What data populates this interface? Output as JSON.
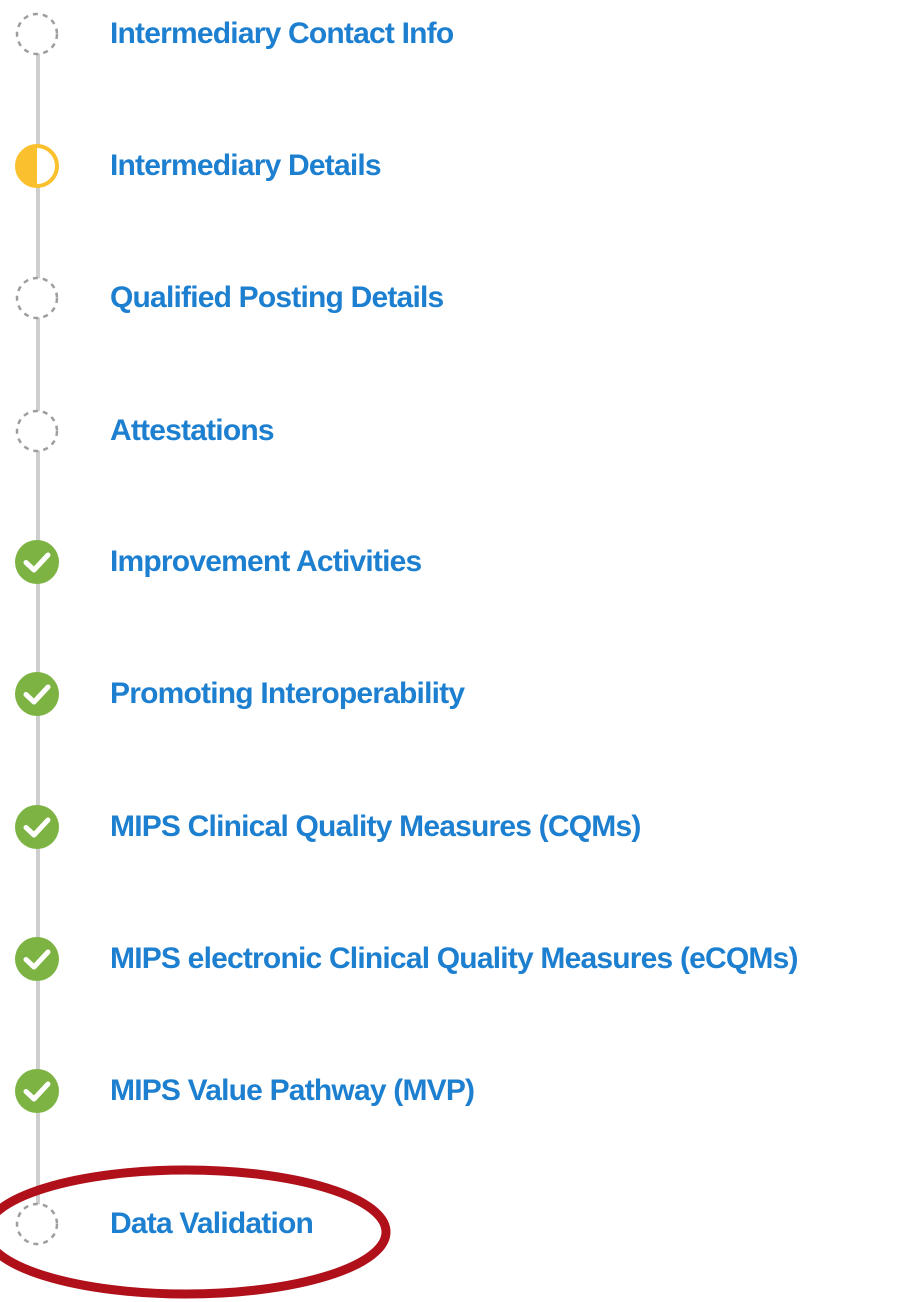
{
  "steps": [
    {
      "label": "Intermediary Contact Info",
      "status": "not-started",
      "status_icon": "dashed-circle-icon"
    },
    {
      "label": "Intermediary Details",
      "status": "in-progress",
      "status_icon": "half-filled-circle-icon"
    },
    {
      "label": "Qualified Posting Details",
      "status": "not-started",
      "status_icon": "dashed-circle-icon"
    },
    {
      "label": "Attestations",
      "status": "not-started",
      "status_icon": "dashed-circle-icon"
    },
    {
      "label": "Improvement Activities",
      "status": "complete",
      "status_icon": "check-circle-icon"
    },
    {
      "label": "Promoting Interoperability",
      "status": "complete",
      "status_icon": "check-circle-icon"
    },
    {
      "label": "MIPS Clinical Quality Measures (CQMs)",
      "status": "complete",
      "status_icon": "check-circle-icon"
    },
    {
      "label": "MIPS electronic Clinical Quality Measures (eCQMs)",
      "status": "complete",
      "status_icon": "check-circle-icon"
    },
    {
      "label": "MIPS Value Pathway (MVP)",
      "status": "complete",
      "status_icon": "check-circle-icon"
    },
    {
      "label": "Data Validation",
      "status": "not-started",
      "status_icon": "dashed-circle-icon",
      "highlighted": true
    }
  ],
  "colors": {
    "link": "#1d7fcf",
    "complete": "#7cb342",
    "in_progress": "#fbc02d",
    "not_started_stroke": "#9e9e9e",
    "rail": "#cfcfcf",
    "highlight": "#b0101a"
  }
}
